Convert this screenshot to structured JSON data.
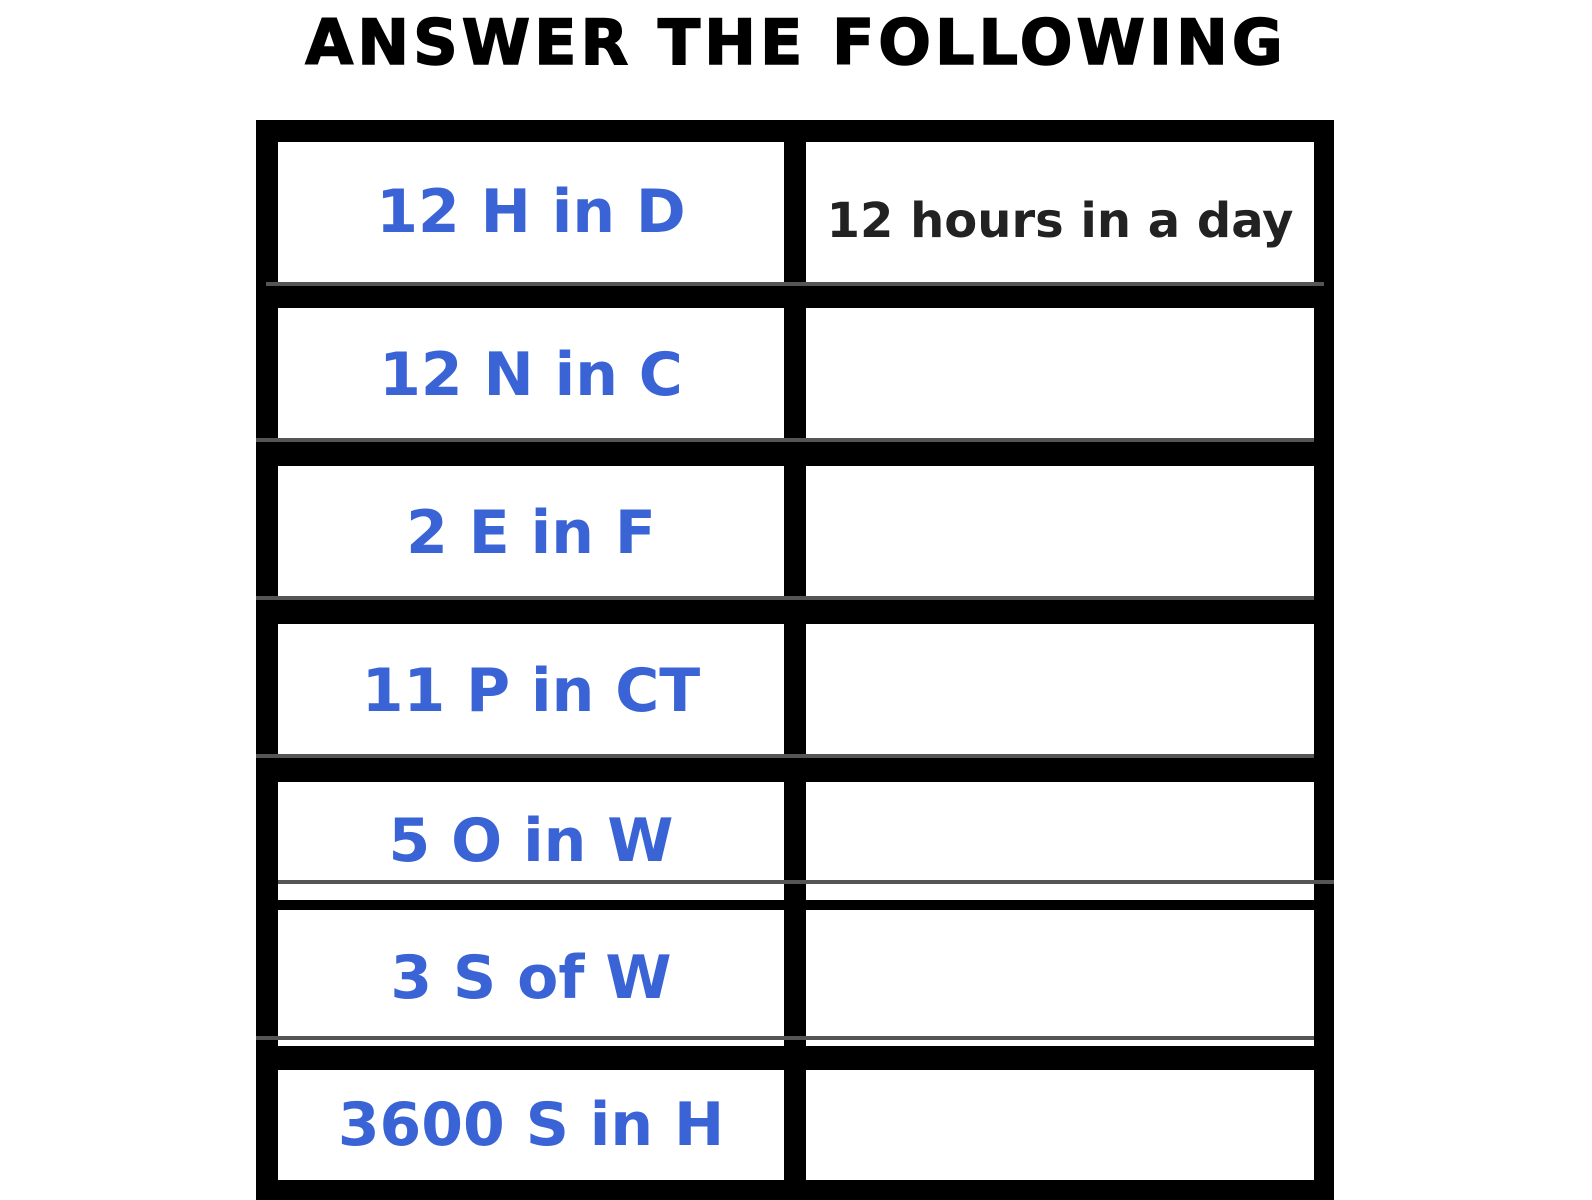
{
  "title": "ANSWER THE FOLLOWING",
  "rows": [
    {
      "question": "12 H in D",
      "answer": "12 hours in a day"
    },
    {
      "question": "12 N in C",
      "answer": ""
    },
    {
      "question": "2 E in F",
      "answer": ""
    },
    {
      "question": "11 P in CT",
      "answer": ""
    },
    {
      "question": "5 O in W",
      "answer": ""
    },
    {
      "question": "3 S of W",
      "answer": ""
    },
    {
      "question": "3600 S in H",
      "answer": ""
    }
  ],
  "colors": {
    "question_text": "#3a64d6",
    "answer_text": "#222222",
    "grid_lines": "#000000"
  }
}
